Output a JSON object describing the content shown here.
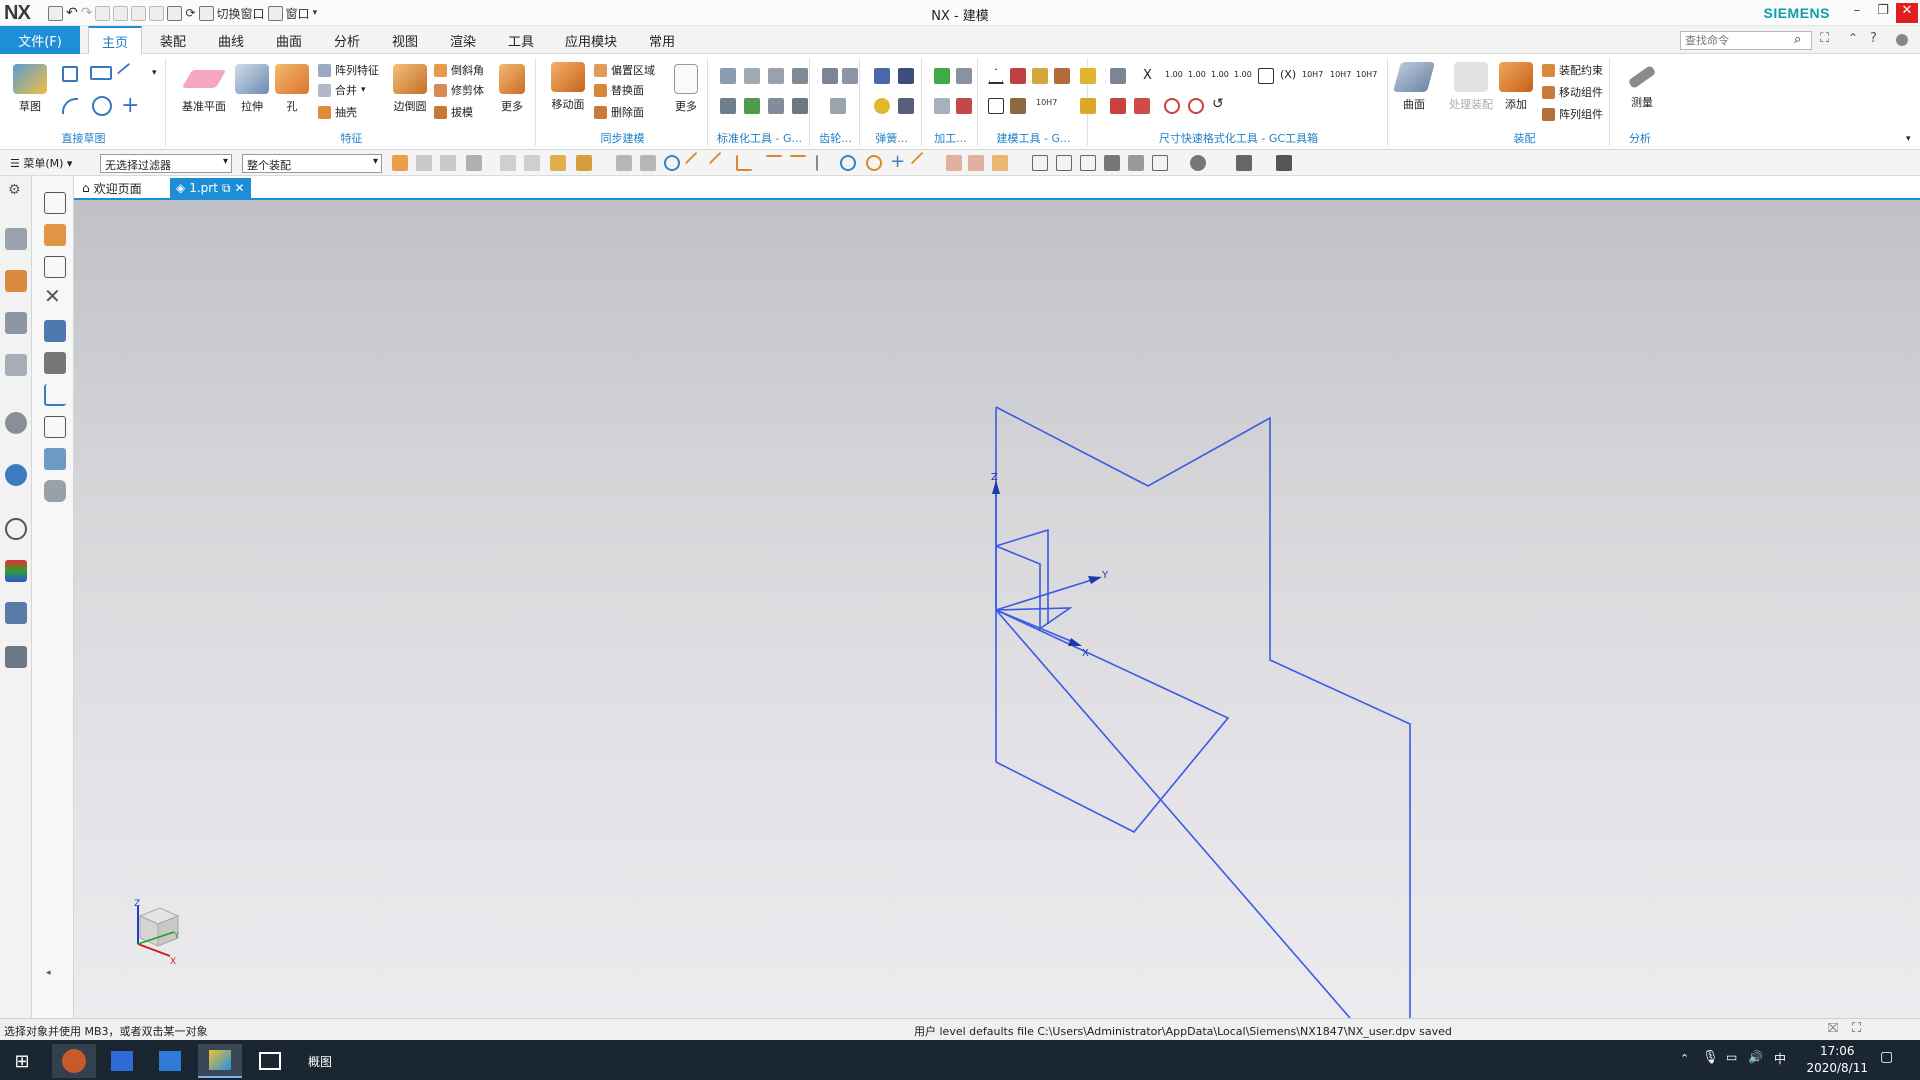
{
  "titlebar": {
    "logo": "NX",
    "title": "NX - 建模",
    "brand": "SIEMENS",
    "switch_window": "切换窗口",
    "window_menu": "窗口"
  },
  "menu": {
    "file": "文件(F)",
    "tabs": [
      "主页",
      "装配",
      "曲线",
      "曲面",
      "分析",
      "视图",
      "渲染",
      "工具",
      "应用模块",
      "常用"
    ],
    "search_placeholder": "查找命令"
  },
  "ribbon": {
    "groups": [
      "直接草图",
      "特征",
      "同步建模",
      "标准化工具 - G...",
      "齿轮...",
      "弹簧...",
      "加工...",
      "建模工具 - G...",
      "尺寸快速格式化工具 - GC工具箱",
      "装配",
      "分析"
    ],
    "sketch_label": "草图",
    "datum_plane": "基准平面",
    "extrude": "拉伸",
    "hole": "孔",
    "pattern_feature": "阵列特征",
    "unite": "合并",
    "shell": "抽壳",
    "edge_blend": "边倒圆",
    "chamfer": "倒斜角",
    "trim_body": "修剪体",
    "draft": "拔模",
    "more1": "更多",
    "move_face": "移动面",
    "offset_region": "偏置区域",
    "replace_face": "替换面",
    "delete_face": "删除面",
    "more2": "更多",
    "dim_values": [
      "1.00",
      "1.00",
      "1.00",
      "1.00",
      "10H7",
      "10H7",
      "10H7"
    ],
    "surface": "曲面",
    "wave_link": "处理装配",
    "add": "添加",
    "assembly_constraints": "装配约束",
    "move_component": "移动组件",
    "pattern_component": "阵列组件",
    "measure": "测量"
  },
  "toolbar2": {
    "menu": "菜单(M)",
    "filter": "无选择过滤器",
    "scope": "整个装配"
  },
  "doc_tabs": {
    "welcome": "欢迎页面",
    "part": "1.prt"
  },
  "viewport": {
    "axis_z": "Z",
    "axis_y": "Y",
    "axis_x": "X",
    "line_color": "#3a5ae6"
  },
  "status": {
    "left": "选择对象并使用 MB3，或者双击某一对象",
    "center": "用户 level defaults file C:\\Users\\Administrator\\AppData\\Local\\Siemens\\NX1847\\NX_user.dpv saved"
  },
  "taskbar": {
    "app_label": "概图",
    "time": "17:06",
    "date": "2020/8/11",
    "ime": "中"
  }
}
